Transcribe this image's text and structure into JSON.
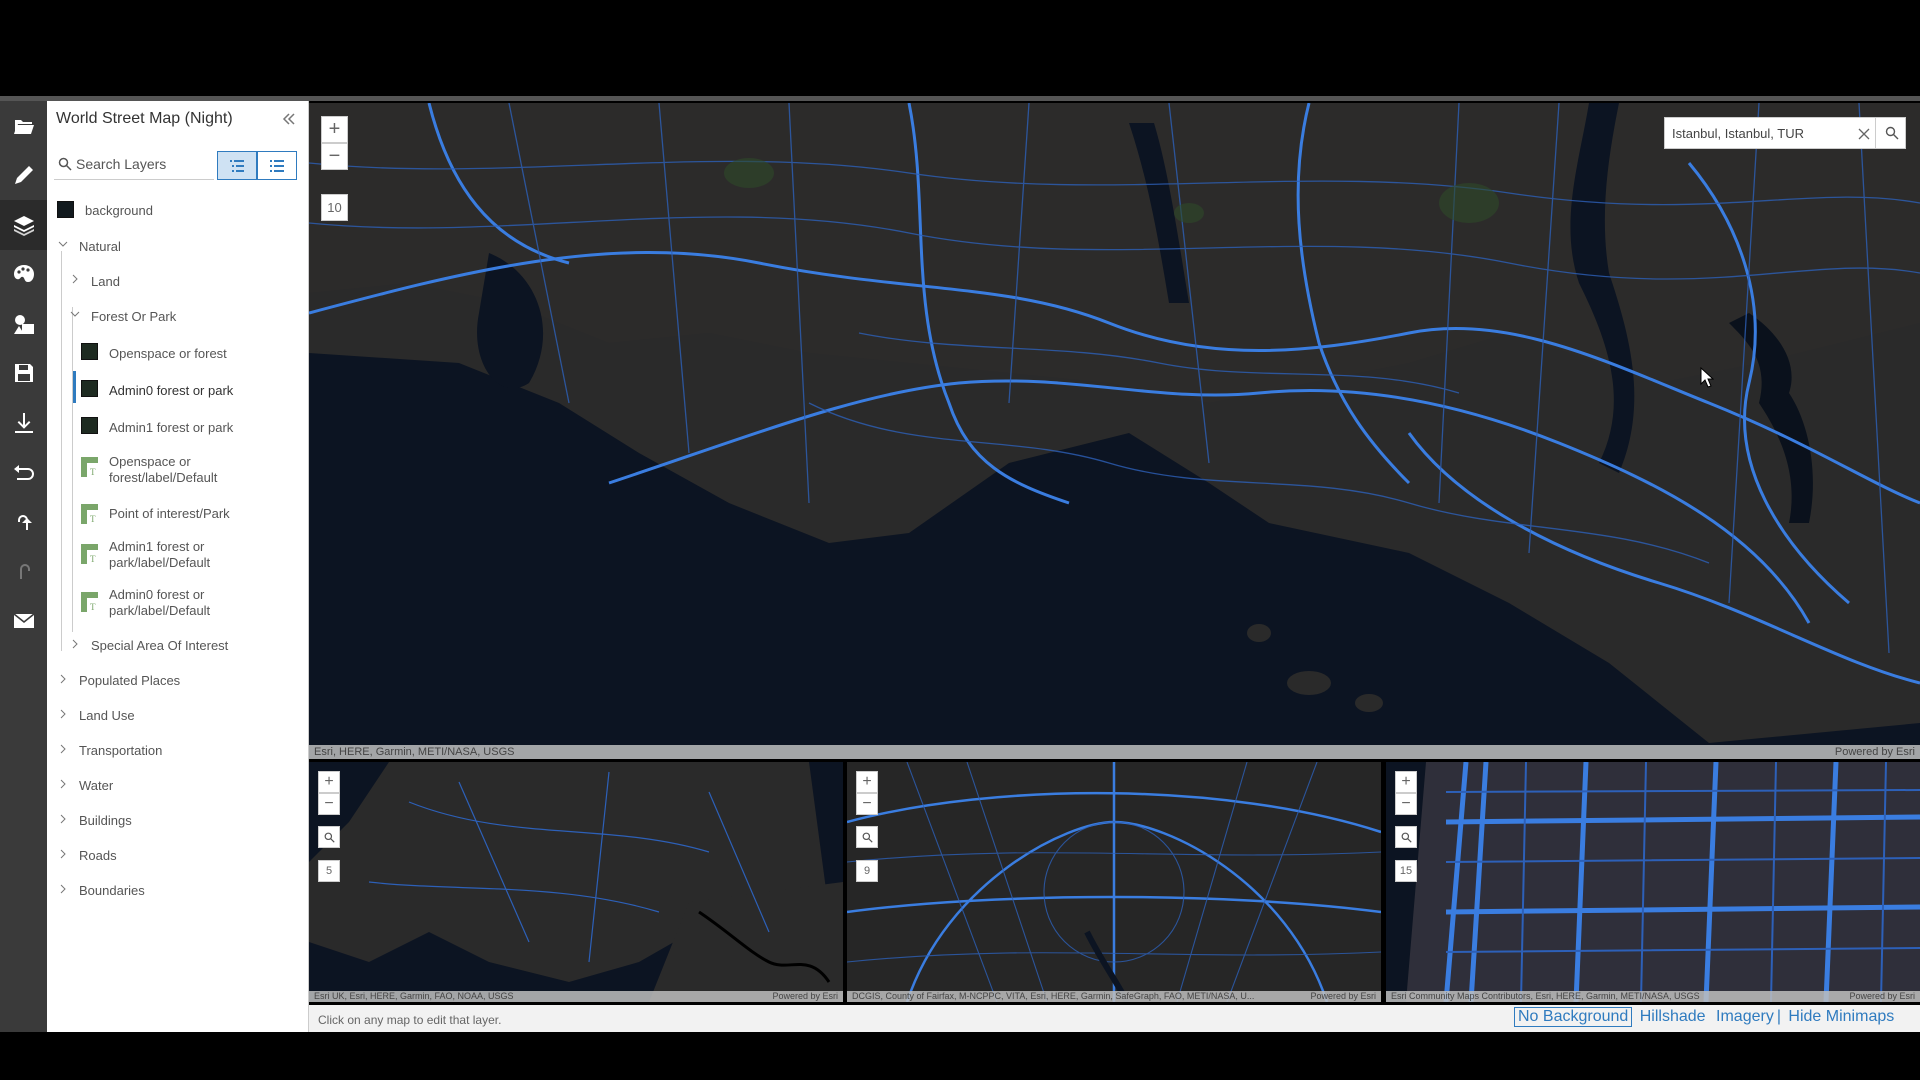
{
  "panel": {
    "title": "World Street Map (Night)",
    "search_placeholder": "Search Layers",
    "layers": [
      {
        "label": "background",
        "kind": "swatch"
      },
      {
        "label": "Natural",
        "kind": "group-open"
      },
      {
        "label": "Land",
        "kind": "group-closed"
      },
      {
        "label": "Forest Or Park",
        "kind": "group-open"
      },
      {
        "label": "Openspace or forest",
        "kind": "swatch"
      },
      {
        "label": "Admin0 forest or park",
        "kind": "swatch",
        "selected": true
      },
      {
        "label": "Admin1 forest or park",
        "kind": "swatch"
      },
      {
        "label": "Openspace or forest/label/Default",
        "kind": "label"
      },
      {
        "label": "Point of interest/Park",
        "kind": "label"
      },
      {
        "label": "Admin1 forest or park/label/Default",
        "kind": "label"
      },
      {
        "label": "Admin0 forest or park/label/Default",
        "kind": "label"
      },
      {
        "label": "Special Area Of Interest",
        "kind": "group-closed"
      },
      {
        "label": "Populated Places",
        "kind": "group-closed"
      },
      {
        "label": "Land Use",
        "kind": "group-closed"
      },
      {
        "label": "Transportation",
        "kind": "group-closed"
      },
      {
        "label": "Water",
        "kind": "group-closed"
      },
      {
        "label": "Buildings",
        "kind": "group-closed"
      },
      {
        "label": "Roads",
        "kind": "group-closed"
      },
      {
        "label": "Boundaries",
        "kind": "group-closed"
      }
    ],
    "label_lines": {
      "openspace_label": [
        "Openspace or",
        "forest/label/Default"
      ],
      "admin1_label": [
        "Admin1 forest or",
        "park/label/Default"
      ],
      "admin0_label": [
        "Admin0 forest or",
        "park/label/Default"
      ]
    }
  },
  "toolbar": {
    "icons": [
      "folder-open-icon",
      "pencil-icon",
      "layers-icon",
      "palette-icon",
      "image-shapes-icon",
      "save-icon",
      "download-icon",
      "revert-icon",
      "undo-icon",
      "redo-icon",
      "mail-icon"
    ]
  },
  "main_map": {
    "zoom_level": "10",
    "search_value": "Istanbul, Istanbul, TUR",
    "attribution": "Esri, HERE, Garmin, METI/NASA, USGS",
    "powered_by": "Powered by Esri"
  },
  "minimaps": [
    {
      "zoom_level": "5",
      "attribution": "Esri UK, Esri, HERE, Garmin, FAO, NOAA, USGS",
      "powered_by": "Powered by Esri"
    },
    {
      "zoom_level": "9",
      "attribution": "DCGIS, County of Fairfax, M-NCPPC, VITA, Esri, HERE, Garmin, SafeGraph, FAO, METI/NASA, U...",
      "powered_by": "Powered by Esri"
    },
    {
      "zoom_level": "15",
      "attribution": "Esri Community Maps Contributors, Esri, HERE, Garmin, METI/NASA, USGS",
      "powered_by": "Powered by Esri"
    }
  ],
  "footer": {
    "hint": "Click on any map to edit that layer.",
    "options": [
      "No Background",
      "Hillshade",
      "Imagery",
      "Hide Minimaps"
    ],
    "separator": "|"
  },
  "colors": {
    "accent": "#2f7bbf",
    "map_water": "#0c1422",
    "map_land": "#2a2a2a",
    "map_roads": "#3a7de0",
    "swatch_forest": "#1e2b21"
  }
}
